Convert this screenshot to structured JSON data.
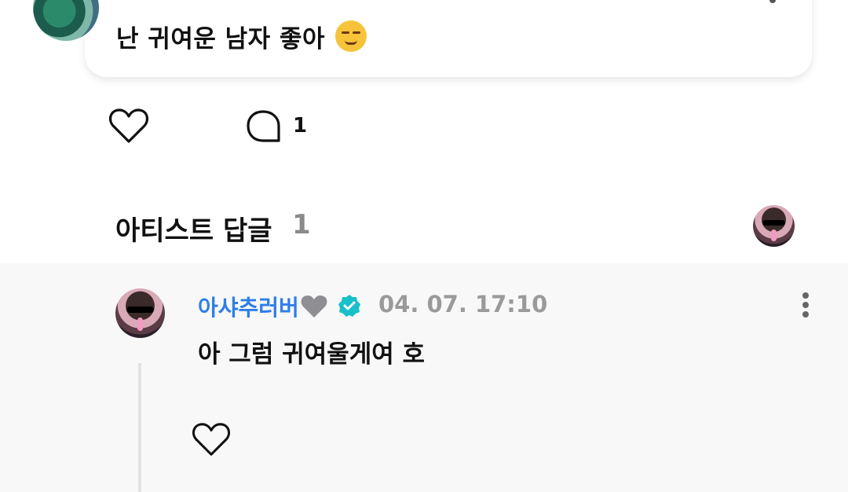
{
  "post": {
    "text": "난 귀여운 남자 좋아",
    "emoji": "smirking-face-emoji",
    "comment_count": "1"
  },
  "artist_replies": {
    "title": "아티스트 답글",
    "count": "1"
  },
  "reply": {
    "author": "아샤추러버",
    "time": "04. 07. 17:10",
    "text": "아 그럼 귀여울게여 호"
  },
  "colors": {
    "author_blue": "#2e7ee8",
    "verified_teal": "#18c0c9",
    "muted_gray": "#9a9a9a"
  }
}
